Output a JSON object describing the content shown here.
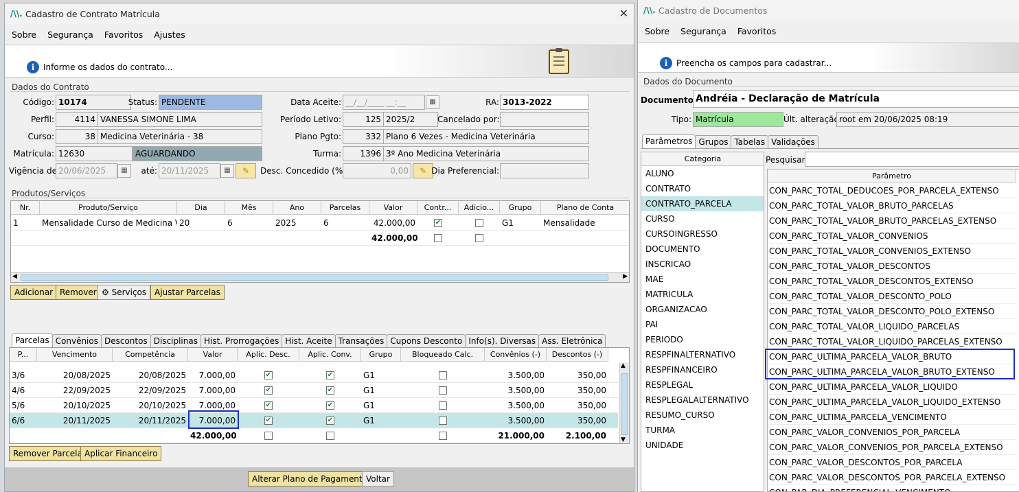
{
  "left": {
    "title": "Cadastro de Contrato Matrícula",
    "menu": [
      "Sobre",
      "Segurança",
      "Favoritos",
      "Ajustes"
    ],
    "info": "Informe os dados do contrato...",
    "group_contract": "Dados do Contrato",
    "labels": {
      "codigo": "Código:",
      "status": "Status:",
      "data_aceite": "Data Aceite:",
      "ra": "RA:",
      "perfil": "Perfil:",
      "periodo": "Período Letivo:",
      "cancelado": "Cancelado por:",
      "curso": "Curso:",
      "plano": "Plano Pgto:",
      "matricula": "Matrícula:",
      "turma": "Turma:",
      "vigencia": "Vigência de:",
      "ate": "até:",
      "desc_concedido": "Desc. Concedido (%):",
      "dia_pref": "Dia Preferencial:"
    },
    "values": {
      "codigo": "10174",
      "status": "PENDENTE",
      "data_aceite": "__/__/____ __:__",
      "ra": "3013-2022",
      "perfil_id": "4114",
      "perfil_nome": "VANESSA SIMONE LIMA",
      "periodo_id": "125",
      "periodo_nome": "2025/2",
      "curso_id": "38",
      "curso_nome": "Medicina Veterinária - 38",
      "plano_id": "332",
      "plano_nome": "Plano 6 Vezes - Medicina Veterinária",
      "matricula_id": "12630",
      "matricula_status": "AGUARDANDO",
      "turma_id": "1396",
      "turma_nome": "3º Ano Medicina Veterinária",
      "vigencia_de": "20/06/2025",
      "vigencia_ate": "20/11/2025",
      "desc_concedido": "0,00"
    },
    "group_products": "Produtos/Serviços",
    "products_headers": [
      "Nr.",
      "Produto/Serviço",
      "Dia",
      "Mês",
      "Ano",
      "Parcelas",
      "Valor",
      "Contr...",
      "Adicio...",
      "Grupo",
      "Plano de Conta"
    ],
    "products_rows": [
      {
        "nr": "1",
        "produto": "Mensalidade Curso de Medicina Ve...",
        "dia": "20",
        "mes": "6",
        "ano": "2025",
        "parcelas": "6",
        "valor": "42.000,00",
        "grupo": "G1",
        "plano": "Mensalidade"
      }
    ],
    "products_total": "42.000,00",
    "buttons1": {
      "adicionar": "Adicionar",
      "remover": "Remover",
      "servicos": "Serviços",
      "ajustar": "Ajustar Parcelas"
    },
    "tabs": [
      "Parcelas",
      "Convênios",
      "Descontos",
      "Disciplinas",
      "Hist. Prorrogações",
      "Hist. Aceite",
      "Transações",
      "Cupons Desconto",
      "Info(s). Diversas",
      "Ass. Eletrônica"
    ],
    "parcelas_headers": [
      "P...",
      "Vencimento",
      "Competência",
      "Valor",
      "Aplic. Desc.",
      "Aplic. Conv.",
      "Grupo",
      "Bloqueado Calc.",
      "Convênios (-)",
      "Descontos (-)"
    ],
    "parcelas_rows": [
      {
        "p": "3/6",
        "venc": "20/08/2025",
        "comp": "20/08/2025",
        "valor": "7.000,00",
        "grupo": "G1",
        "conv": "3.500,00",
        "desc": "350,00"
      },
      {
        "p": "4/6",
        "venc": "22/09/2025",
        "comp": "22/09/2025",
        "valor": "7.000,00",
        "grupo": "G1",
        "conv": "3.500,00",
        "desc": "350,00"
      },
      {
        "p": "5/6",
        "venc": "20/10/2025",
        "comp": "20/10/2025",
        "valor": "7.000,00",
        "grupo": "G1",
        "conv": "3.500,00",
        "desc": "350,00"
      },
      {
        "p": "6/6",
        "venc": "20/11/2025",
        "comp": "20/11/2025",
        "valor": "7.000,00",
        "grupo": "G1",
        "conv": "3.500,00",
        "desc": "350,00"
      }
    ],
    "parcelas_total": {
      "valor": "42.000,00",
      "conv": "21.000,00",
      "desc": "2.100,00"
    },
    "buttons2": {
      "remover_parcela": "Remover Parcela",
      "aplicar": "Aplicar Financeiro"
    },
    "buttons3": {
      "alterar": "Alterar Plano de Pagamento",
      "voltar": "Voltar"
    }
  },
  "right": {
    "title": "Cadastro de Documentos",
    "menu": [
      "Sobre",
      "Segurança",
      "Favoritos"
    ],
    "info": "Preencha os campos para cadastrar...",
    "group_doc": "Dados do Documento",
    "labels": {
      "documento": "Documento:",
      "tipo": "Tipo:",
      "ult": "Últ. alteração:",
      "pesquisar": "Pesquisar:"
    },
    "values": {
      "documento": "Andréia - Declaração de Matrícula",
      "tipo": "Matrícula",
      "ult": "root em 20/06/2025 08:19"
    },
    "tabs": [
      "Parâmetros",
      "Grupos",
      "Tabelas",
      "Validações"
    ],
    "categoria_header": "Categoria",
    "categorias": [
      "ALUNO",
      "CONTRATO",
      "CONTRATO_PARCELA",
      "CURSO",
      "CURSOINGRESSO",
      "DOCUMENTO",
      "INSCRICAO",
      "MAE",
      "MATRICULA",
      "ORGANIZACAO",
      "PAI",
      "PERIODO",
      "RESPFINALTERNATIVO",
      "RESPFINANCEIRO",
      "RESPLEGAL",
      "RESPLEGALALTERNATIVO",
      "RESUMO_CURSO",
      "TURMA",
      "UNIDADE"
    ],
    "parametro_header": "Parâmetro",
    "parametros": [
      "CON_PARC_TOTAL_DEDUCOES_POR_PARCELA_EXTENSO",
      "CON_PARC_TOTAL_VALOR_BRUTO_PARCELAS",
      "CON_PARC_TOTAL_VALOR_BRUTO_PARCELAS_EXTENSO",
      "CON_PARC_TOTAL_VALOR_CONVENIOS",
      "CON_PARC_TOTAL_VALOR_CONVENIOS_EXTENSO",
      "CON_PARC_TOTAL_VALOR_DESCONTOS",
      "CON_PARC_TOTAL_VALOR_DESCONTOS_EXTENSO",
      "CON_PARC_TOTAL_VALOR_DESCONTO_POLO",
      "CON_PARC_TOTAL_VALOR_DESCONTO_POLO_EXTENSO",
      "CON_PARC_TOTAL_VALOR_LIQUIDO_PARCELAS",
      "CON_PARC_TOTAL_VALOR_LIQUIDO_PARCELAS_EXTENSO",
      "CON_PARC_ULTIMA_PARCELA_VALOR_BRUTO",
      "CON_PARC_ULTIMA_PARCELA_VALOR_BRUTO_EXTENSO",
      "CON_PARC_ULTIMA_PARCELA_VALOR_LIQUIDO",
      "CON_PARC_ULTIMA_PARCELA_VALOR_LIQUIDO_EXTENSO",
      "CON_PARC_ULTIMA_PARCELA_VENCIMENTO",
      "CON_PARC_VALOR_CONVENIOS_POR_PARCELA",
      "CON_PARC_VALOR_CONVENIOS_POR_PARCELA_EXTENSO",
      "CON_PARC_VALOR_DESCONTOS_POR_PARCELA",
      "CON_PARC_VALOR_DESCONTOS_POR_PARCELA_EXTENSO",
      "CON_PAR_DIA_PREFERENCIAL_VENCIMENTO"
    ]
  },
  "colors": {
    "status": "#9db9e2",
    "aguardando": "#93a9b1",
    "tipo": "#9ee89e",
    "selected": "#c4e6e7",
    "highlight": "#1a2fc4",
    "button": "#efe2a3"
  }
}
